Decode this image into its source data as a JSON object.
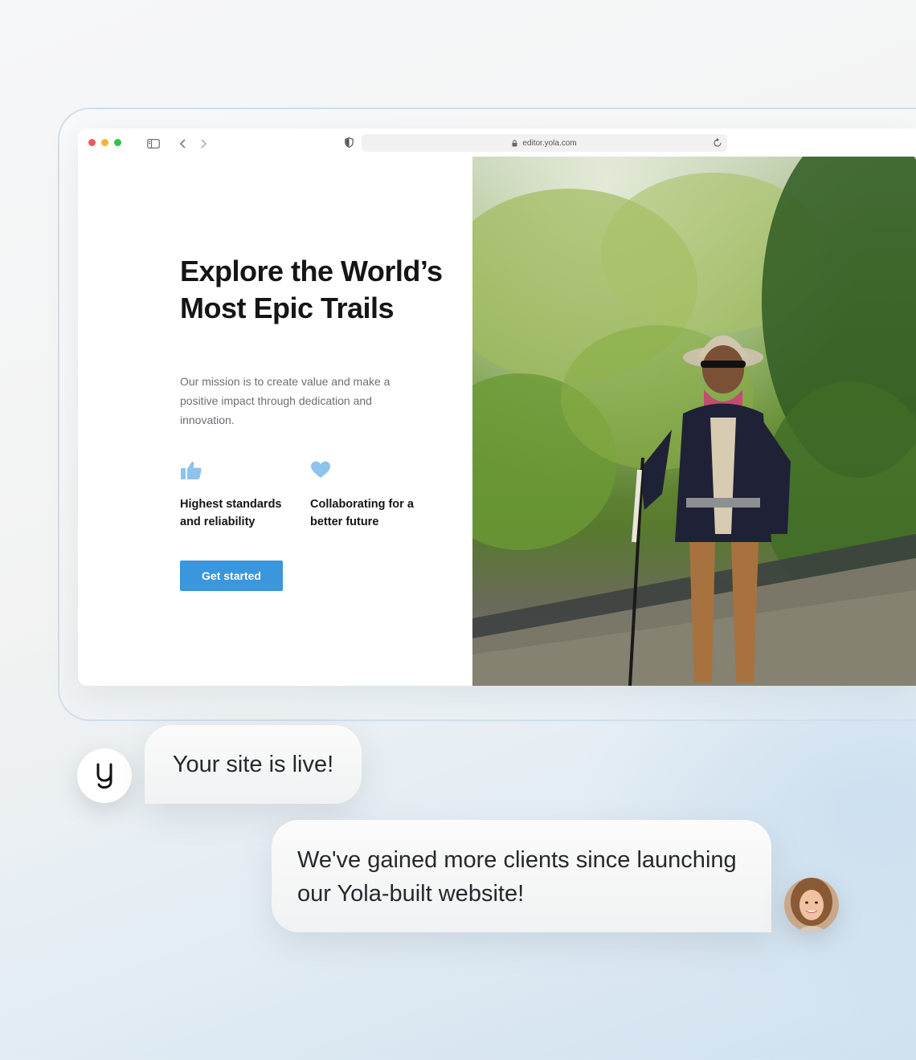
{
  "browser": {
    "url": "editor.yola.com"
  },
  "hero": {
    "headline": "Explore the World’s Most Epic Trails",
    "mission": "Our mission is to create value and make a positive impact through dedication and innovation.",
    "features": [
      {
        "icon": "thumbs-up-icon",
        "label": "Highest standards and reliability"
      },
      {
        "icon": "heart-icon",
        "label": "Collaborating for a better future"
      }
    ],
    "cta_label": "Get started"
  },
  "chat": {
    "system_message": "Your site is live!",
    "user_message": "We've gained more clients since launching our Yola-built website!"
  },
  "colors": {
    "accent": "#3a96dd",
    "feature_icon": "#8ec3ec",
    "headline": "#151515"
  }
}
